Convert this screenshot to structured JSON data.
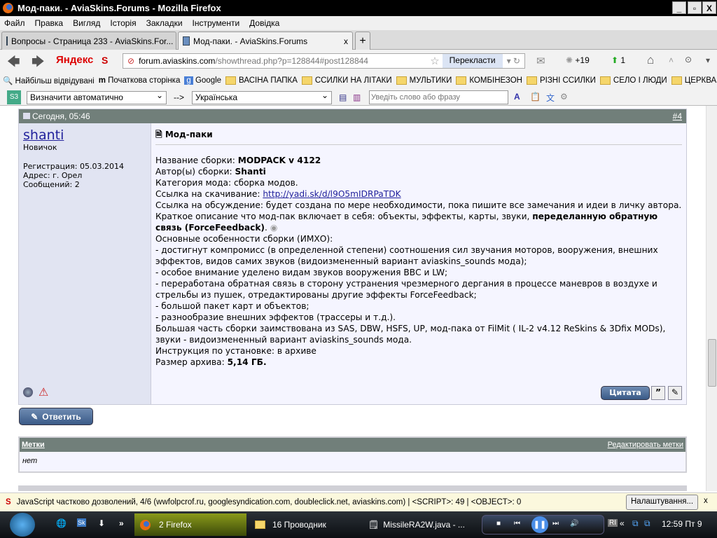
{
  "window": {
    "title": "Мод-паки. - AviaSkins.Forums - Mozilla Firefox"
  },
  "menu": [
    "Файл",
    "Правка",
    "Вигляд",
    "Історія",
    "Закладки",
    "Інструменти",
    "Довідка"
  ],
  "tabs": [
    {
      "label": "Вопросы - Страница 233 - AviaSkins.For..."
    },
    {
      "label": "Мод-паки. - AviaSkins.Forums"
    }
  ],
  "nav": {
    "yandex": "Яндекс",
    "url_domain": "forum.aviaskins.com",
    "url_path": "/showthread.php?p=128844#post128844",
    "translate": "Перекласти",
    "weather": "+19",
    "count": "1"
  },
  "bookmarks": [
    "Найбільш відвідувані",
    "Початкова сторінка",
    "Google",
    "ВАСІНА ПАПКА",
    "ССИЛКИ НА ЛІТАКИ",
    "МУЛЬТИКИ",
    "КОМБІНЕЗОН",
    "РІЗНІ ССИЛКИ",
    "СЕЛО І ЛЮДИ",
    "ЦЕРКВА"
  ],
  "translator": {
    "from": "Визначити автоматично",
    "arrow": "-->",
    "to": "Українська",
    "placeholder": "Уведіть слово або фразу"
  },
  "post": {
    "date": "Сегодня, 05:46",
    "number": "#4",
    "author": "shanti",
    "rank": "Новичок",
    "reg": "Регистрация: 05.03.2014",
    "address": "Адрес: г. Орел",
    "posts": "Сообщений: 2",
    "title": "Мод-паки",
    "l1a": "Название сборки: ",
    "l1b": "MODPACK v 4122",
    "l2a": "Автор(ы) сборки: ",
    "l2b": "Shanti",
    "l3": "Категория мода: сборка модов.",
    "l4a": "Ссылка на скачивание: ",
    "l4link": "http://yadi.sk/d/l9O5mIDRPaTDK",
    "l5": "Ссылка на обсуждение: будет создана по мере необходимости, пока пишите все замечания и идеи в личку автора.",
    "l6a": "Краткое описание что мод-пак включает в себя: объекты, эффекты, карты, звуки, ",
    "l6b": "переделанную обратную связь (ForceFeedback)",
    "l6c": ".",
    "lines": [
      "Основные особенности сборки (ИМХО):",
      "- достигнут компромисс (в определенной степени) соотношения сил звучания моторов, вооружения, внешних эффектов, видов самих звуков (видоизмененный вариант aviaskins_sounds мода);",
      "- особое внимание уделено видам звуков вооружения ВВС и LW;",
      "- переработана обратная связь в сторону устранения чрезмерного дергания в процессе маневров в воздухе и стрельбы из пушек, отредактированы другие эффекты ForceFeedback;",
      "- большой пакет карт и объектов;",
      "- разнообразие внешних эффектов (трассеры и т.д.).",
      "Большая часть сборки заимствована из SAS, DBW, HSFS, UP, мод-пака от FilMit ( IL-2 v4.12 ReSkins & 3Dfix MODs), звуки - видоизмененный вариант aviaskins_sounds мода.",
      "Инструкция по установке: в архиве"
    ],
    "sizea": "Размер архива: ",
    "sizeb": "5,14 ГБ.",
    "quote": "Цитата"
  },
  "reply": "Ответить",
  "tags": {
    "title": "Метки",
    "edit": "Редактировать метки",
    "value": "нет"
  },
  "scriptbar": {
    "text": "JavaScript частково дозволений, 4/6 (wwfolpcrof.ru, googlesyndication.com, doubleclick.net, aviaskins.com) | <SCRIPT>: 49 | <OBJECT>: 0",
    "settings": "Налаштування...",
    "close": "x"
  },
  "taskbar": {
    "firefox": "2 Firefox",
    "explorer": "16 Проводник",
    "java": "MissileRA2W.java - ...",
    "lang": "RI",
    "clock": "12:59 Пт 9"
  }
}
